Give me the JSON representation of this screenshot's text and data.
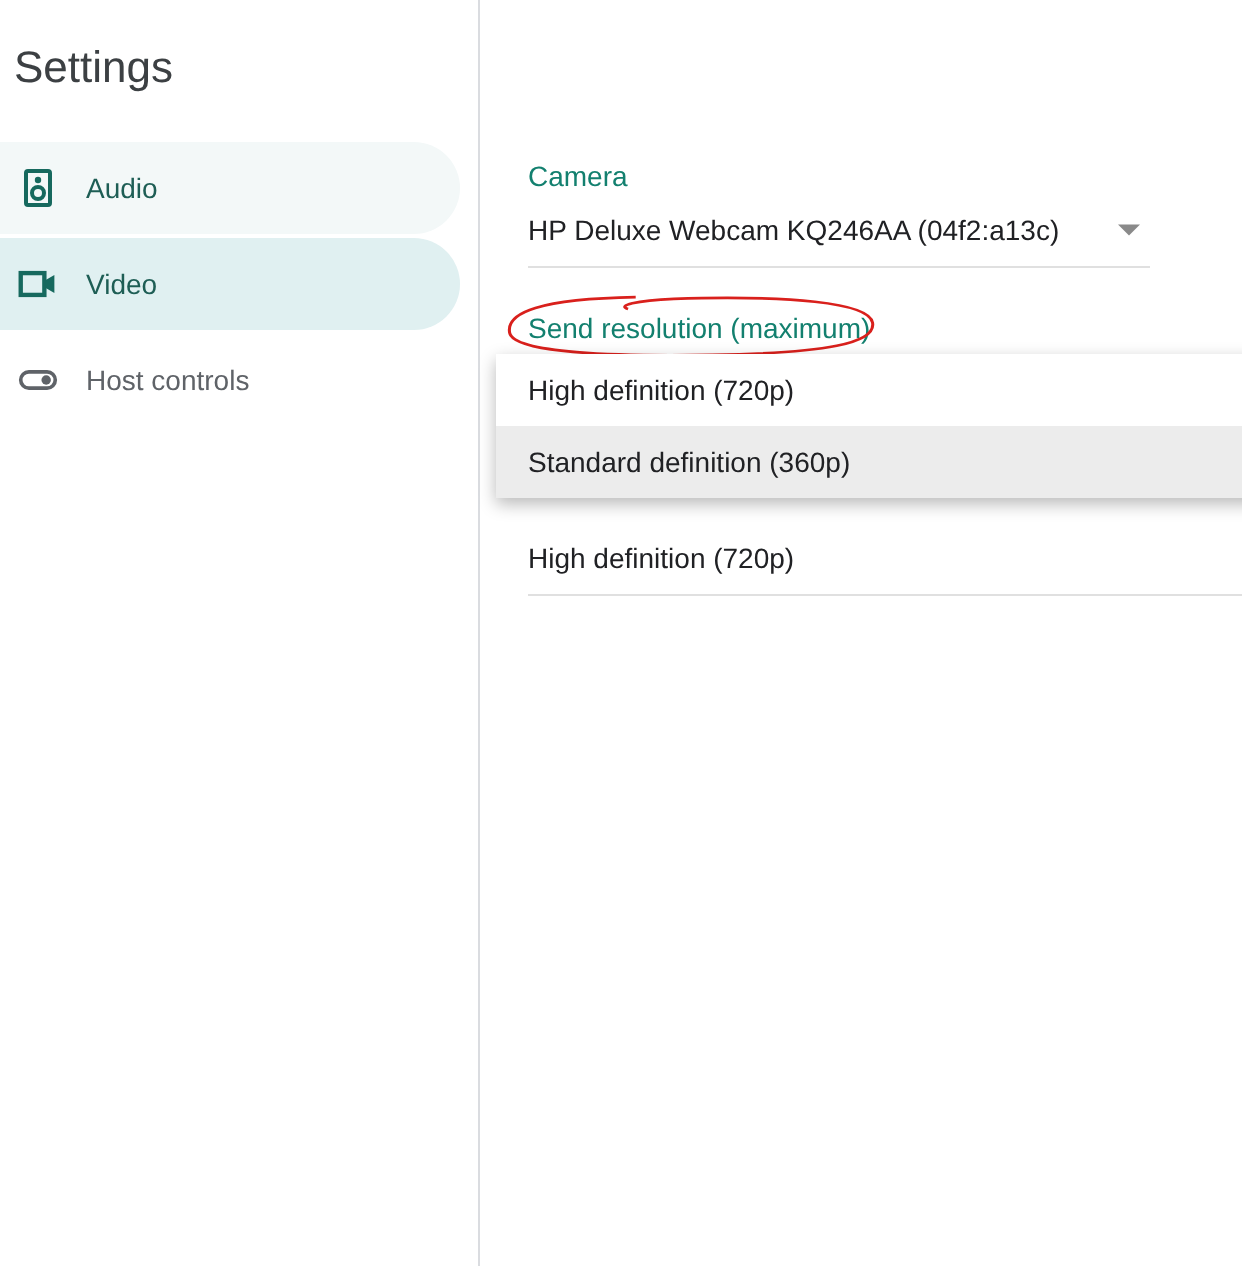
{
  "sidebar": {
    "title": "Settings",
    "items": [
      {
        "kind": "speaker",
        "label": "Audio",
        "selected": false,
        "hovered": true
      },
      {
        "kind": "camera",
        "label": "Video",
        "selected": true,
        "hovered": false
      },
      {
        "kind": "toggle",
        "label": "Host controls",
        "selected": false,
        "hovered": false
      }
    ]
  },
  "camera": {
    "label": "Camera",
    "value": "HP Deluxe Webcam KQ246AA (04f2:a13c)"
  },
  "send_resolution": {
    "label": "Send resolution (maximum)",
    "circled": true,
    "menu": [
      {
        "label": "High definition (720p)",
        "highlighted": false
      },
      {
        "label": "Standard definition (360p)",
        "highlighted": true
      }
    ]
  },
  "receive_resolution": {
    "value": "High definition (720p)"
  }
}
